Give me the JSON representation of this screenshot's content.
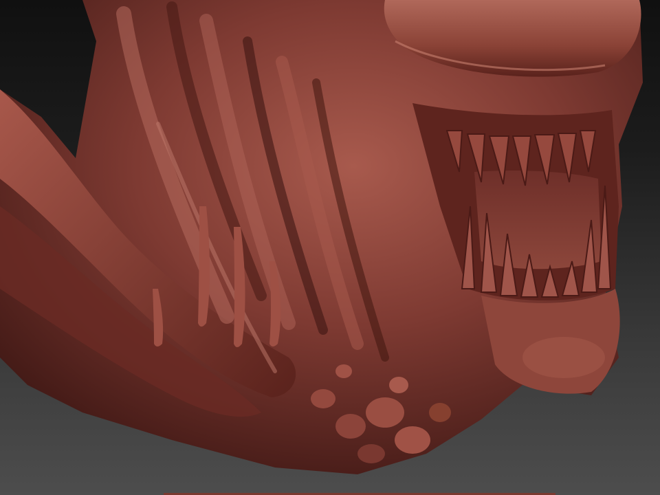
{
  "viewport": {
    "subject": "sculpted-creature-head",
    "material_color": "#7e3a32",
    "highlight_color": "#b06457",
    "shadow_color": "#3a1512",
    "background_top": "#101010",
    "background_bottom": "#4d4d4d"
  }
}
